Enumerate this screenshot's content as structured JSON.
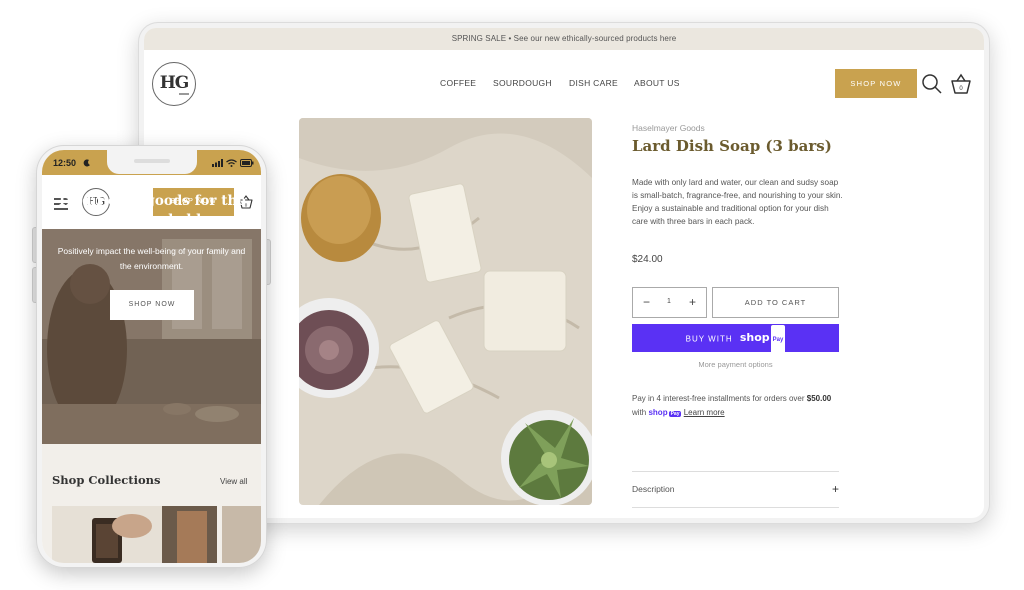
{
  "desktop": {
    "announcement": "SPRING SALE • See our new ethically-sourced products here",
    "logo_text": "HG",
    "nav": [
      {
        "label": "COFFEE"
      },
      {
        "label": "SOURDOUGH"
      },
      {
        "label": "DISH CARE"
      },
      {
        "label": "ABOUT US"
      }
    ],
    "shop_now": "SHOP NOW",
    "cart_count": "0",
    "product": {
      "brand": "Haselmayer Goods",
      "title": "Lard Dish Soap (3 bars)",
      "description": "Made with only lard and water, our clean and sudsy soap is small-batch, fragrance-free, and nourishing to your skin. Enjoy a sustainable and traditional option for your dish care with three bars in each pack.",
      "price": "$24.00",
      "quantity": "1",
      "add_to_cart": "ADD TO CART",
      "buy_with": "BUY WITH",
      "shop_pay_word": "shop",
      "shop_pay_badge": "Pay",
      "more_payment": "More payment options",
      "installments_text": "Pay in 4 interest-free installments for orders over",
      "installments_amount": "$50.00",
      "installments_with": "with",
      "learn_more": "Learn more",
      "description_tab": "Description"
    }
  },
  "mobile": {
    "time": "12:50",
    "logo_text": "HG",
    "shop_now": "SHOP NOW",
    "cart_count": "0",
    "hero": {
      "title": "Traditional goods for the naturally-minded home.",
      "subtitle": "Positively impact the well-being of your family and the environment.",
      "button": "SHOP NOW"
    },
    "collections": {
      "title": "Shop Collections",
      "view_all": "View all"
    }
  },
  "colors": {
    "gold": "#c9a24f",
    "shop_pay_purple": "#5a31f4",
    "title_brown": "#6b5b2e",
    "announcement_bg": "#ebe7df"
  }
}
